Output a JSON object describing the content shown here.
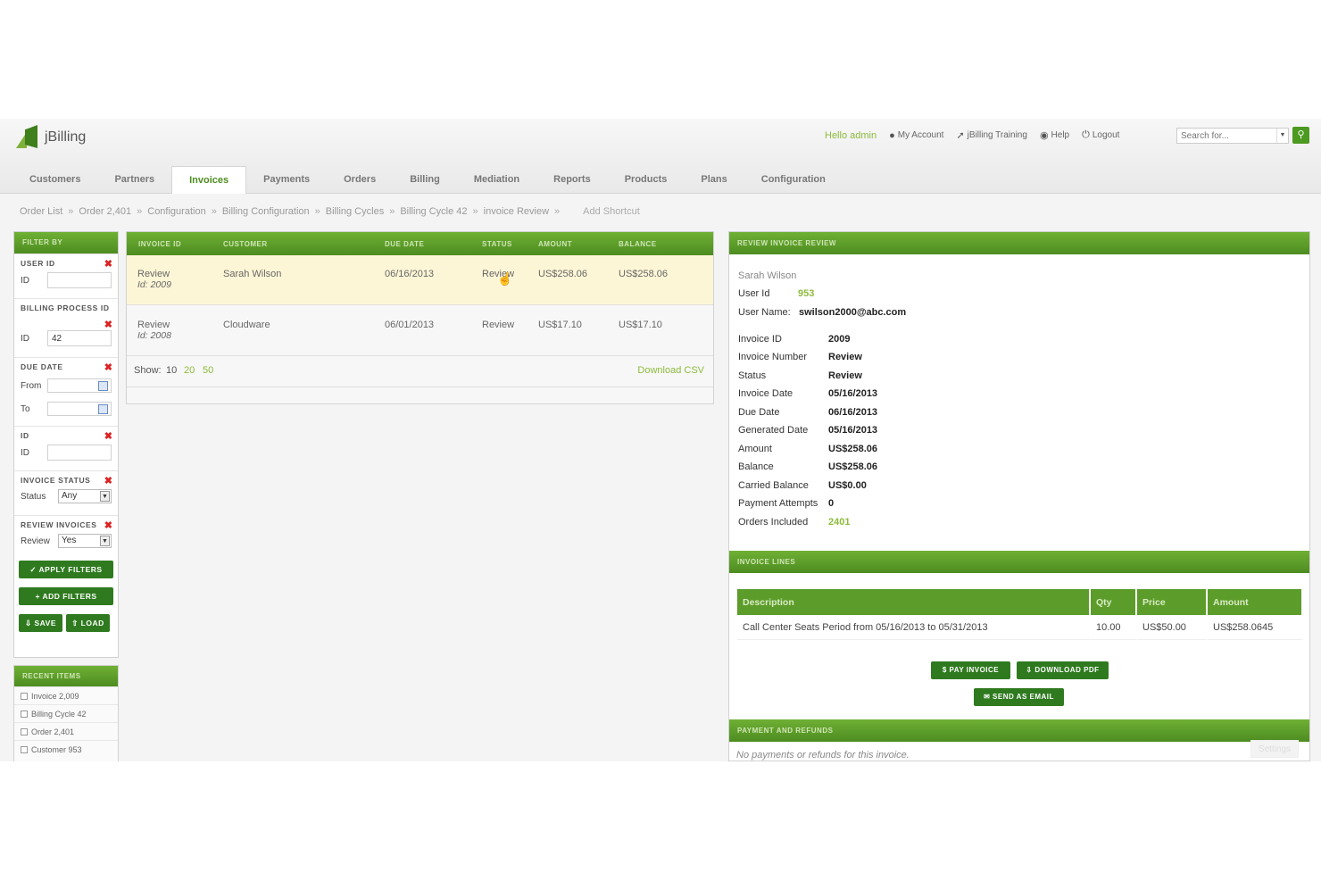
{
  "app": {
    "logo_text": "jBilling"
  },
  "topbar": {
    "hello": "Hello admin",
    "links": [
      {
        "label": "My Account",
        "icon": "user-icon"
      },
      {
        "label": "jBilling Training",
        "icon": "pin-icon"
      },
      {
        "label": "Help",
        "icon": "help-icon"
      },
      {
        "label": "Logout",
        "icon": "power-icon"
      }
    ],
    "search_placeholder": "Search for..."
  },
  "nav": {
    "tabs": [
      "Customers",
      "Partners",
      "Invoices",
      "Payments",
      "Orders",
      "Billing",
      "Mediation",
      "Reports",
      "Products",
      "Plans",
      "Configuration"
    ],
    "active": "Invoices"
  },
  "breadcrumbs": [
    "Order List",
    "Order 2,401",
    "Configuration",
    "Billing Configuration",
    "Billing Cycles",
    "Billing Cycle 42",
    "invoice Review"
  ],
  "breadcrumb_separator": "»",
  "add_shortcut": "Add Shortcut",
  "filter": {
    "title": "FILTER BY",
    "user_id": {
      "title": "USER ID",
      "label": "ID",
      "value": ""
    },
    "billing_process": {
      "title": "BILLING PROCESS ID",
      "label": "ID",
      "value": "42"
    },
    "due_date": {
      "title": "DUE DATE",
      "from_label": "From",
      "to_label": "To"
    },
    "id": {
      "title": "ID",
      "label": "ID",
      "value": ""
    },
    "invoice_status": {
      "title": "INVOICE STATUS",
      "label": "Status",
      "value": "Any"
    },
    "review_invoices": {
      "title": "REVIEW INVOICES",
      "label": "Review",
      "value": "Yes"
    },
    "apply_label": "✓ APPLY FILTERS",
    "add_label": "+ ADD FILTERS",
    "save_label": "⇩ SAVE",
    "load_label": "⇧ LOAD"
  },
  "recent": {
    "title": "RECENT ITEMS",
    "items": [
      "Invoice 2,009",
      "Billing Cycle 42",
      "Order 2,401",
      "Customer 953"
    ]
  },
  "list": {
    "columns": [
      "INVOICE ID",
      "CUSTOMER",
      "DUE DATE",
      "STATUS",
      "AMOUNT",
      "BALANCE"
    ],
    "rows": [
      {
        "id_label": "Review",
        "id_sub": "Id: 2009",
        "customer": "Sarah  Wilson",
        "due": "06/16/2013",
        "status": "Review",
        "amount": "US$258.06",
        "balance": "US$258.06",
        "selected": true
      },
      {
        "id_label": "Review",
        "id_sub": "Id: 2008",
        "customer": "Cloudware",
        "due": "06/01/2013",
        "status": "Review",
        "amount": "US$17.10",
        "balance": "US$17.10",
        "selected": false
      }
    ],
    "show_label": "Show:",
    "page_sizes": [
      "10",
      "20",
      "50"
    ],
    "download_csv": "Download CSV"
  },
  "review": {
    "title": "REVIEW INVOICE REVIEW",
    "customer_name": "Sarah Wilson",
    "user_id_label": "User Id",
    "user_id": "953",
    "user_name_label": "User Name:",
    "user_name": "swilson2000@abc.com",
    "fields": [
      {
        "label": "Invoice ID",
        "value": "2009"
      },
      {
        "label": "Invoice Number",
        "value": "Review"
      },
      {
        "label": "Status",
        "value": "Review"
      },
      {
        "label": "Invoice Date",
        "value": "05/16/2013"
      },
      {
        "label": "Due Date",
        "value": "06/16/2013"
      },
      {
        "label": "Generated Date",
        "value": "05/16/2013"
      },
      {
        "label": "Amount",
        "value": "US$258.06"
      },
      {
        "label": "Balance",
        "value": "US$258.06"
      },
      {
        "label": "Carried Balance",
        "value": "US$0.00"
      },
      {
        "label": "Payment Attempts",
        "value": "0"
      },
      {
        "label": "Orders Included",
        "value": "2401"
      }
    ],
    "lines_title": "INVOICE LINES",
    "lines_columns": [
      "Description",
      "Qty",
      "Price",
      "Amount"
    ],
    "lines": [
      {
        "description": "Call Center Seats Period from 05/16/2013 to 05/31/2013",
        "qty": "10.00",
        "price": "US$50.00",
        "amount": "US$258.0645"
      }
    ],
    "pay_invoice": "$ PAY INVOICE",
    "download_pdf": "⇩ DOWNLOAD PDF",
    "send_email": "✉ SEND AS EMAIL",
    "payments_title": "PAYMENT AND REFUNDS",
    "no_payments": "No payments or refunds for this invoice.",
    "settings": "Settings"
  },
  "colors": {
    "brand_green": "#4d8c20",
    "link_green": "#8dbb3c",
    "delete_red": "#dd2222",
    "selected_row": "#fdf6d6"
  }
}
